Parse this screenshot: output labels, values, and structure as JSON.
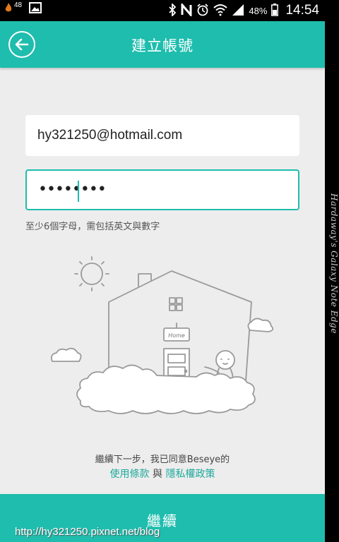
{
  "status_bar": {
    "notification_badge": "48",
    "battery_percent": "48%",
    "time": "14:54",
    "icons": [
      "fire-icon",
      "image-icon",
      "bluetooth-icon",
      "nfc-icon",
      "alarm-icon",
      "wifi-icon",
      "signal-icon",
      "battery-icon"
    ]
  },
  "header": {
    "title": "建立帳號",
    "back_icon": "back-arrow-icon"
  },
  "form": {
    "email_value": "hy321250@hotmail.com",
    "password_masked": "••••••••",
    "password_hint": "至少6個字母，需包括英文與數字"
  },
  "illustration": {
    "sign_text": "Home"
  },
  "terms": {
    "prefix": "繼續下一步，我已同意Beseye的",
    "terms_link": "使用條款",
    "and": "與",
    "privacy_link": "隱私權政策"
  },
  "footer": {
    "continue_label": "繼續"
  },
  "watermark": "http://hy321250.pixnet.net/blog",
  "edge_caption": "Hardaway's Galaxy Note Edge",
  "colors": {
    "accent": "#1fbdae",
    "link": "#1fa99c",
    "background": "#ededed"
  }
}
